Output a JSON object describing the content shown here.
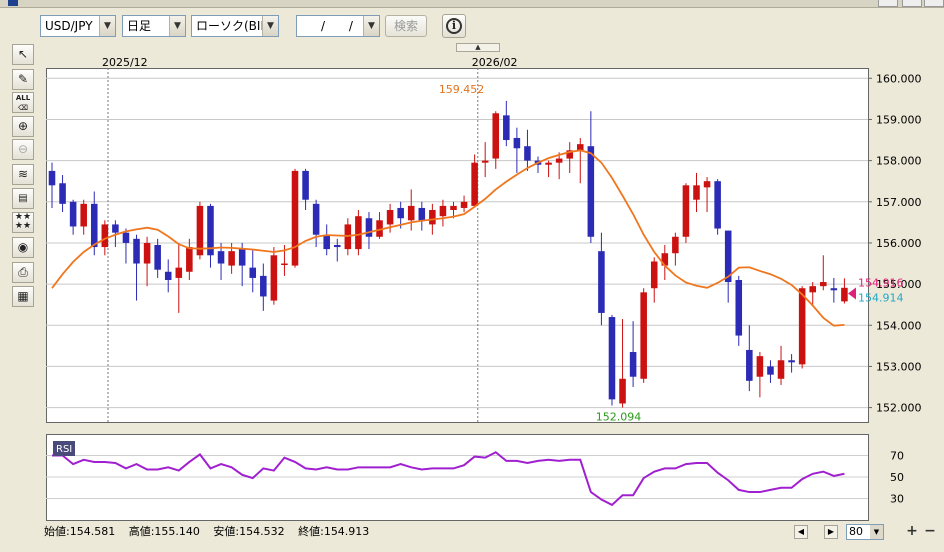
{
  "toolbar": {
    "symbol": "USD/JPY",
    "timeframe": "日足",
    "price_type": "ローソク(BID)",
    "date_value": "/ /",
    "search_label": "検索",
    "info_label": "i"
  },
  "side_tools": [
    "cursor-icon",
    "pen-icon",
    "clear-all-icon",
    "zoom-in-icon",
    "zoom-out-icon",
    "indicator-icon",
    "data-table-icon",
    "objects-icon",
    "eye-icon",
    "print-icon",
    "grid-icon"
  ],
  "side_tool_labels": {
    "clear_all": "ALL"
  },
  "colors": {
    "up": "#cc1111",
    "down": "#2b2bb5",
    "ma": "#f0761e",
    "rsi": "#a020d0",
    "high_label": "#e27420",
    "low_label": "#2a9a1a",
    "bid_label": "#e0207a",
    "ask_label": "#21a8c8"
  },
  "chart_data": {
    "type": "candlestick",
    "date_labels": [
      "2025/12",
      "2026/02"
    ],
    "y_ticks": [
      "160.000",
      "159.000",
      "158.000",
      "157.000",
      "156.000",
      "155.000",
      "154.000",
      "153.000",
      "152.000"
    ],
    "ylim": [
      151.65,
      160.25
    ],
    "high_label": "159.452",
    "low_label": "152.094",
    "price_bid": "154.916",
    "price_ask": "154.914",
    "candles": [
      [
        157.75,
        157.4,
        157.95,
        156.85
      ],
      [
        157.45,
        156.95,
        157.65,
        156.75
      ],
      [
        157.0,
        156.4,
        157.05,
        156.2
      ],
      [
        156.4,
        156.95,
        157.05,
        156.2
      ],
      [
        156.95,
        155.9,
        157.25,
        155.7
      ],
      [
        155.9,
        156.45,
        156.55,
        155.7
      ],
      [
        156.45,
        156.25,
        156.55,
        155.9
      ],
      [
        156.25,
        156.0,
        156.35,
        155.5
      ],
      [
        156.1,
        155.5,
        156.2,
        154.6
      ],
      [
        155.5,
        156.0,
        156.15,
        154.95
      ],
      [
        155.95,
        155.35,
        156.1,
        155.15
      ],
      [
        155.3,
        155.1,
        155.6,
        154.8
      ],
      [
        155.15,
        155.4,
        156.0,
        154.3
      ],
      [
        155.3,
        155.9,
        156.1,
        155.1
      ],
      [
        155.7,
        156.9,
        157.0,
        155.6
      ],
      [
        156.9,
        155.7,
        156.95,
        155.4
      ],
      [
        155.8,
        155.5,
        156.0,
        155.1
      ],
      [
        155.45,
        155.8,
        156.0,
        155.25
      ],
      [
        155.85,
        155.45,
        156.0,
        154.95
      ],
      [
        155.4,
        155.15,
        155.85,
        154.8
      ],
      [
        155.2,
        154.7,
        155.5,
        154.35
      ],
      [
        154.6,
        155.7,
        155.9,
        154.5
      ],
      [
        155.5,
        155.5,
        155.95,
        155.2
      ],
      [
        155.45,
        157.75,
        157.8,
        155.4
      ],
      [
        157.75,
        157.05,
        157.8,
        156.8
      ],
      [
        156.95,
        156.2,
        157.05,
        155.9
      ],
      [
        156.2,
        155.85,
        156.45,
        155.7
      ],
      [
        155.95,
        155.9,
        156.1,
        155.55
      ],
      [
        155.85,
        156.45,
        156.6,
        155.7
      ],
      [
        155.85,
        156.65,
        156.8,
        155.7
      ],
      [
        156.6,
        156.15,
        156.75,
        155.85
      ],
      [
        156.15,
        156.55,
        156.75,
        156.1
      ],
      [
        156.45,
        156.8,
        156.95,
        156.25
      ],
      [
        156.85,
        156.6,
        157.0,
        156.35
      ],
      [
        156.55,
        156.9,
        157.3,
        156.3
      ],
      [
        156.85,
        156.55,
        157.0,
        156.3
      ],
      [
        156.45,
        156.8,
        156.95,
        156.2
      ],
      [
        156.65,
        156.9,
        157.05,
        156.4
      ],
      [
        156.8,
        156.9,
        157.0,
        156.6
      ],
      [
        156.85,
        157.0,
        157.15,
        156.75
      ],
      [
        156.9,
        157.95,
        158.15,
        156.9
      ],
      [
        157.95,
        158.0,
        158.45,
        157.6
      ],
      [
        158.05,
        159.15,
        159.2,
        157.8
      ],
      [
        159.1,
        158.5,
        159.45,
        158.35
      ],
      [
        158.55,
        158.3,
        158.8,
        157.7
      ],
      [
        158.35,
        158.0,
        158.75,
        157.75
      ],
      [
        158.0,
        157.9,
        158.1,
        157.7
      ],
      [
        157.9,
        157.95,
        158.0,
        157.6
      ],
      [
        157.95,
        158.05,
        158.2,
        157.55
      ],
      [
        158.05,
        158.25,
        158.45,
        157.7
      ],
      [
        158.25,
        158.4,
        158.55,
        157.45
      ],
      [
        158.35,
        156.15,
        159.2,
        156.0
      ],
      [
        155.8,
        154.3,
        156.25,
        154.0
      ],
      [
        154.2,
        152.2,
        154.25,
        152.05
      ],
      [
        152.1,
        152.7,
        154.15,
        152.0
      ],
      [
        153.35,
        152.75,
        154.1,
        152.5
      ],
      [
        152.7,
        154.8,
        154.9,
        152.6
      ],
      [
        154.9,
        155.55,
        155.65,
        154.55
      ],
      [
        155.45,
        155.75,
        155.95,
        155.1
      ],
      [
        155.75,
        156.15,
        156.25,
        155.45
      ],
      [
        156.15,
        157.4,
        157.45,
        156.0
      ],
      [
        157.05,
        157.4,
        157.7,
        156.75
      ],
      [
        157.35,
        157.5,
        157.6,
        156.75
      ],
      [
        157.5,
        156.35,
        157.55,
        156.2
      ],
      [
        156.3,
        155.05,
        156.3,
        154.55
      ],
      [
        155.1,
        153.75,
        155.2,
        153.5
      ],
      [
        153.4,
        152.65,
        154.0,
        152.4
      ],
      [
        152.75,
        153.25,
        153.35,
        152.25
      ],
      [
        153.0,
        152.8,
        153.15,
        152.6
      ],
      [
        152.7,
        153.15,
        153.5,
        152.55
      ],
      [
        153.15,
        153.1,
        153.3,
        152.85
      ],
      [
        153.05,
        154.9,
        154.95,
        152.95
      ],
      [
        154.8,
        154.95,
        155.05,
        154.5
      ],
      [
        154.95,
        155.05,
        155.7,
        154.85
      ],
      [
        154.9,
        154.85,
        155.15,
        154.55
      ],
      [
        154.58,
        154.91,
        155.14,
        154.53
      ]
    ],
    "ma": [
      154.9,
      155.24,
      155.54,
      155.78,
      155.96,
      156.1,
      156.2,
      156.28,
      156.33,
      156.37,
      156.32,
      156.16,
      155.97,
      155.87,
      155.86,
      155.87,
      155.89,
      155.88,
      155.86,
      155.84,
      155.81,
      155.78,
      155.82,
      155.9,
      156.05,
      156.15,
      156.19,
      156.18,
      156.17,
      156.2,
      156.26,
      156.32,
      156.38,
      156.44,
      156.5,
      156.54,
      156.57,
      156.6,
      156.64,
      156.7,
      156.88,
      157.07,
      157.3,
      157.49,
      157.66,
      157.82,
      157.95,
      158.06,
      158.14,
      158.21,
      158.25,
      158.18,
      157.95,
      157.58,
      157.15,
      156.7,
      156.2,
      155.78,
      155.45,
      155.21,
      155.04,
      154.96,
      154.91,
      155.03,
      155.18,
      155.4,
      155.41,
      155.32,
      155.24,
      155.13,
      154.98,
      154.75,
      154.48,
      154.18,
      153.99,
      154.01
    ],
    "rsi": {
      "levels": [
        "70",
        "50",
        "30"
      ],
      "label": "RSI",
      "ylim": [
        10,
        90
      ],
      "values": [
        70,
        70,
        62,
        66,
        64,
        64,
        63,
        58,
        62,
        57,
        57,
        59,
        56,
        64,
        71,
        58,
        62,
        59,
        52,
        49,
        58,
        56,
        68,
        64,
        58,
        57,
        59,
        57,
        57,
        59,
        59,
        59,
        59,
        62,
        59,
        57,
        58,
        58,
        58,
        61,
        69,
        68,
        73,
        65,
        65,
        63,
        65,
        66,
        65,
        66,
        66,
        36,
        29,
        24,
        33,
        33,
        49,
        55,
        58,
        58,
        62,
        63,
        63,
        54,
        47,
        38,
        36,
        36,
        38,
        40,
        40,
        48,
        53,
        55,
        51,
        53
      ]
    }
  },
  "status": {
    "open": "始値:154.581",
    "high": "高値:155.140",
    "low": "安値:154.532",
    "close": "終値:154.913"
  },
  "zoom_value": "80"
}
